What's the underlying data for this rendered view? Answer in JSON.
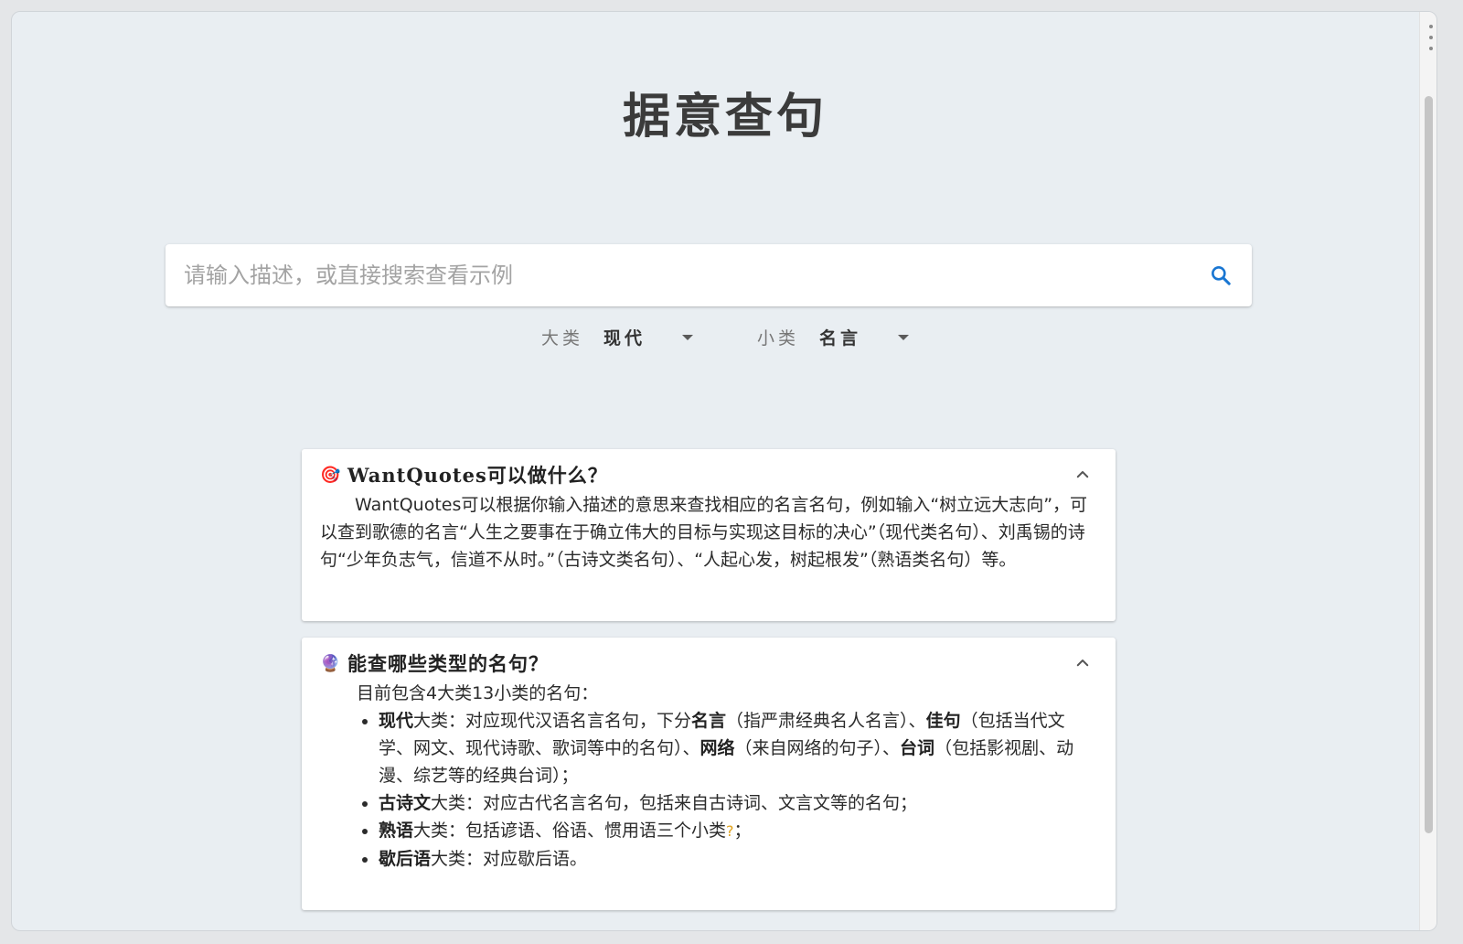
{
  "page": {
    "title": "据意查句"
  },
  "search": {
    "placeholder": "请输入描述，或直接搜索查看示例"
  },
  "filters": {
    "major_label": "大类",
    "major_value": "现代",
    "minor_label": "小类",
    "minor_value": "名言"
  },
  "cards": {
    "what": {
      "emoji": "🎯",
      "title": "WantQuotes可以做什么？",
      "body": "WantQuotes可以根据你输入描述的意思来查找相应的名言名句，例如输入“树立远大志向”，可以查到歌德的名言“人生之要事在于确立伟大的目标与实现这目标的决心”（现代类名句）、刘禹锡的诗句“少年负志气，信道不从时。”（古诗文类名句）、“人起心发，树起根发”（熟语类名句）等。"
    },
    "types": {
      "emoji": "🔮",
      "title": "能查哪些类型的名句？",
      "intro": "目前包含4大类13小类的名句：",
      "items": {
        "modern": {
          "strong": "现代",
          "t1": "大类：对应现代汉语名言名句，下分",
          "s2": "名言",
          "t2": "（指严肃经典名人名言）、",
          "s3": "佳句",
          "t3": "（包括当代文学、网文、现代诗歌、歌词等中的名句）、",
          "s4": "网络",
          "t4": "（来自网络的句子）、",
          "s5": "台词",
          "t5": "（包括影视剧、动漫、综艺等的经典台词）；"
        },
        "classical": {
          "strong": "古诗文",
          "text": "大类：对应古代名言名句，包括来自古诗词、文言文等的名句；"
        },
        "idiom": {
          "strong": "熟语",
          "text": "大类：包括谚语、俗语、惯用语三个小类",
          "qmark": "?",
          "tail": "；"
        },
        "xiehouyu": {
          "strong": "歇后语",
          "text": "大类：对应歇后语。"
        }
      }
    }
  },
  "colors": {
    "background": "#e9eef2",
    "search_icon": "#1976d2",
    "title_text": "#3b3b3b"
  },
  "icons": {
    "search": "search-icon",
    "collapse": "chevron-up-icon",
    "dropdown": "caret-down-icon"
  }
}
